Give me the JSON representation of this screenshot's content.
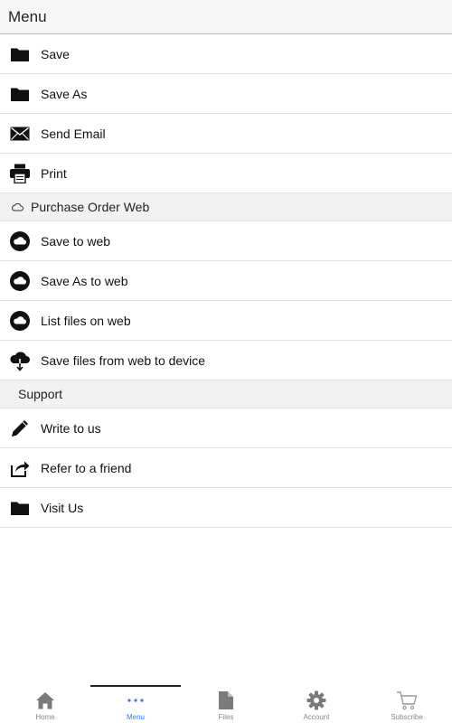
{
  "header": {
    "title": "Menu"
  },
  "file_items": [
    {
      "label": "Save",
      "icon": "folder-icon"
    },
    {
      "label": "Save As",
      "icon": "folder-icon"
    },
    {
      "label": "Send Email",
      "icon": "envelope-icon"
    },
    {
      "label": "Print",
      "icon": "printer-icon"
    }
  ],
  "web_section": {
    "title": "Purchase Order Web",
    "icon": "cloud-outline-icon"
  },
  "web_items": [
    {
      "label": "Save to web",
      "icon": "cloud-circle-icon"
    },
    {
      "label": "Save As to web",
      "icon": "cloud-circle-icon"
    },
    {
      "label": "List files on web",
      "icon": "cloud-circle-icon"
    },
    {
      "label": "Save files from web to device",
      "icon": "cloud-download-icon"
    }
  ],
  "support_section": {
    "title": "Support"
  },
  "support_items": [
    {
      "label": "Write to us",
      "icon": "pencil-icon"
    },
    {
      "label": "Refer to a friend",
      "icon": "share-icon"
    },
    {
      "label": "Visit Us",
      "icon": "folder-icon"
    }
  ],
  "tabbar": {
    "active": "Menu",
    "accent": "#3478f6",
    "tabs": [
      {
        "label": "Home",
        "icon": "home-icon"
      },
      {
        "label": "Menu",
        "icon": "ellipsis-icon"
      },
      {
        "label": "Files",
        "icon": "document-icon"
      },
      {
        "label": "Account",
        "icon": "gear-icon"
      },
      {
        "label": "Subscribe",
        "icon": "cart-icon"
      }
    ]
  }
}
